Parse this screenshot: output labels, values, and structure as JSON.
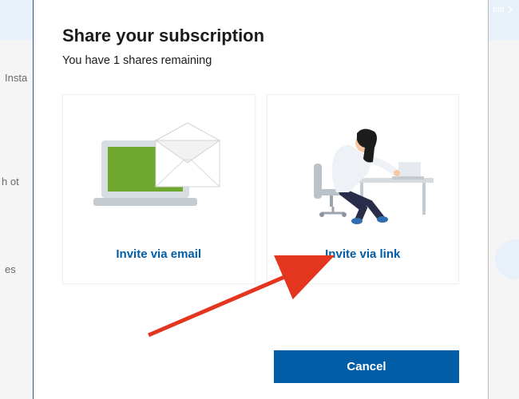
{
  "background": {
    "install_text": "Insta",
    "other_text": "h ot",
    "es_text": "es",
    "top_right_fragment": "ple"
  },
  "modal": {
    "title": "Share your subscription",
    "subtitle": "You have 1 shares remaining",
    "cards": {
      "email": {
        "label": "Invite via email"
      },
      "link": {
        "label": "Invite via link"
      }
    },
    "cancel_label": "Cancel"
  },
  "colors": {
    "accent": "#005da6",
    "arrow": "#e4351f"
  }
}
